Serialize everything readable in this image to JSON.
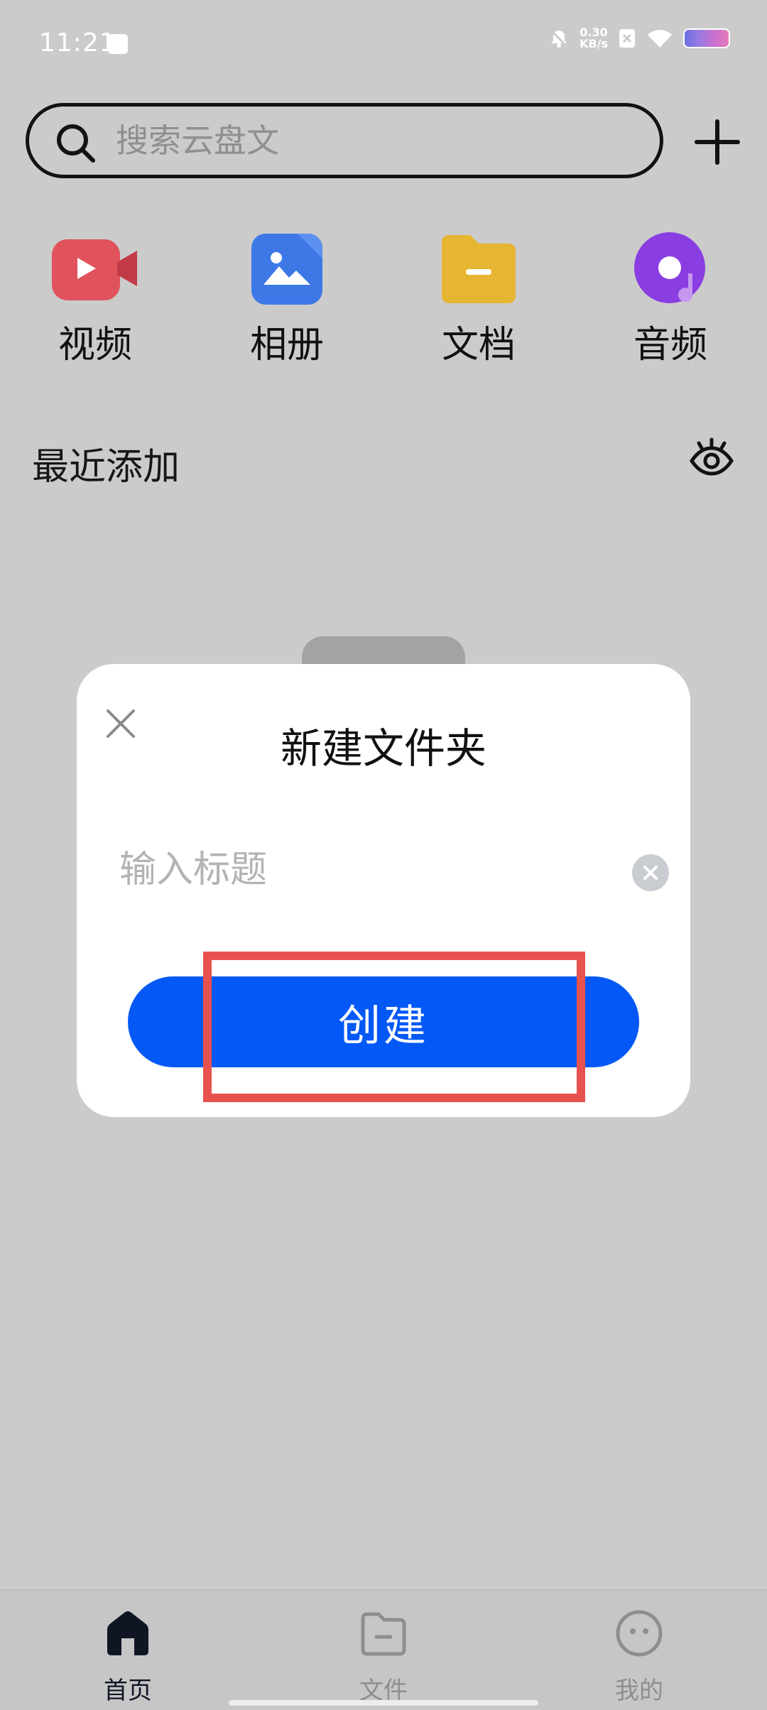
{
  "status_bar": {
    "time": "11:21",
    "net_speed_value": "0.30",
    "net_speed_unit": "KB/s"
  },
  "search": {
    "placeholder": "搜索云盘文"
  },
  "categories": [
    {
      "label": "视频",
      "icon": "video-camera-icon",
      "color": "#e0525c"
    },
    {
      "label": "相册",
      "icon": "photo-album-icon",
      "color": "#3d78e6"
    },
    {
      "label": "文档",
      "icon": "folder-document-icon",
      "color": "#e6b531"
    },
    {
      "label": "音频",
      "icon": "music-disc-icon",
      "color": "#8a3de0"
    }
  ],
  "recent": {
    "title": "最近添加"
  },
  "dialog": {
    "title": "新建文件夹",
    "input_placeholder": "输入标题",
    "create_label": "创建"
  },
  "bottom_nav": {
    "items": [
      {
        "label": "首页",
        "icon": "home-icon",
        "active": true
      },
      {
        "label": "文件",
        "icon": "file-folder-icon",
        "active": false
      },
      {
        "label": "我的",
        "icon": "profile-face-icon",
        "active": false
      }
    ]
  },
  "colors": {
    "background": "#cbcbcb",
    "primary": "#0459f6",
    "highlight": "#e8524e"
  }
}
